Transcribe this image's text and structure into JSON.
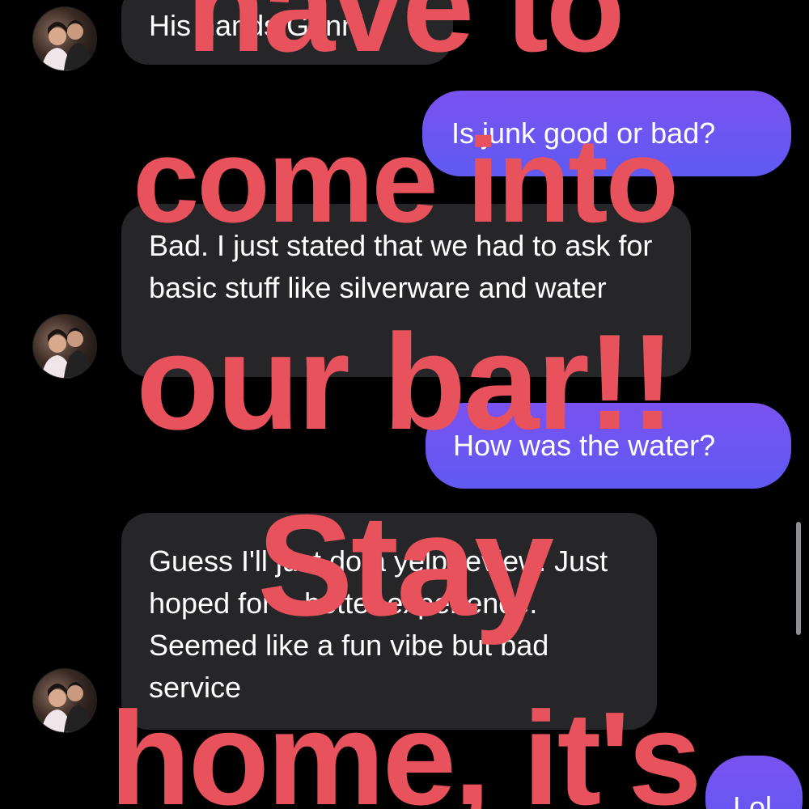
{
  "conversation": {
    "messages": [
      {
        "sender": "them",
        "text": "His hands.Genni"
      },
      {
        "sender": "me",
        "text": "Is junk good or bad?"
      },
      {
        "sender": "them",
        "text": "Bad. I just stated that we had to ask for basic stuff like silverware and water"
      },
      {
        "sender": "me",
        "text": "How was the water?"
      },
      {
        "sender": "them",
        "text": "Guess I'll just do a yelp review. Just hoped for a better experience. Seemed like a fun vibe but bad service"
      },
      {
        "sender": "me",
        "text": "Lol"
      }
    ]
  },
  "overlay_caption": {
    "lines": [
      "have to",
      "come into",
      "our bar!!",
      "Stay",
      "home, it's"
    ],
    "color": "#e8525c"
  },
  "colors": {
    "background": "#000000",
    "incoming_bubble": "#262628",
    "outgoing_bubble_top": "#7a52f0",
    "outgoing_bubble_bottom": "#5f5af2",
    "text": "#ffffff"
  },
  "icons": [
    "avatar-photo"
  ]
}
